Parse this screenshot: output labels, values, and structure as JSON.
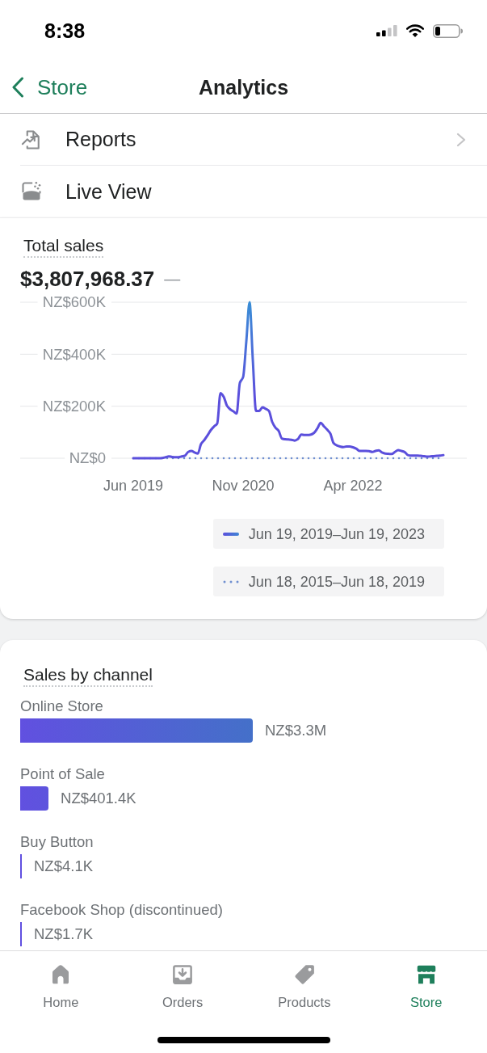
{
  "status_bar": {
    "time": "8:38"
  },
  "nav": {
    "back_label": "Store",
    "title": "Analytics"
  },
  "menu": [
    {
      "label": "Reports",
      "chevron": true
    },
    {
      "label": "Live View",
      "chevron": false
    }
  ],
  "total_sales": {
    "title": "Total sales",
    "amount": "$3,807,968.37",
    "comparison": "—",
    "y_axis_labels": [
      "NZ$600K",
      "NZ$400K",
      "NZ$200K",
      "NZ$0"
    ],
    "x_axis_labels": [
      "Jun 2019",
      "Nov 2020",
      "Apr 2022"
    ],
    "legend": [
      {
        "label": "Jun 19, 2019–Jun 19, 2023",
        "kind": "solid"
      },
      {
        "label": "Jun 18, 2015–Jun 18, 2019",
        "kind": "dotted"
      }
    ]
  },
  "sales_by_channel": {
    "title": "Sales by channel",
    "chart_data": {
      "type": "bar",
      "orientation": "horizontal",
      "categories": [
        "Online Store",
        "Point of Sale",
        "Buy Button",
        "Facebook Shop (discontinued)"
      ],
      "values": [
        3300000,
        401400,
        4100,
        1700
      ],
      "value_labels": [
        "NZ$3.3M",
        "NZ$401.4K",
        "NZ$4.1K",
        "NZ$1.7K"
      ]
    }
  },
  "tab_bar": {
    "tabs": [
      {
        "label": "Home",
        "selected": false
      },
      {
        "label": "Orders",
        "selected": false
      },
      {
        "label": "Products",
        "selected": false
      },
      {
        "label": "Store",
        "selected": true
      }
    ]
  }
}
